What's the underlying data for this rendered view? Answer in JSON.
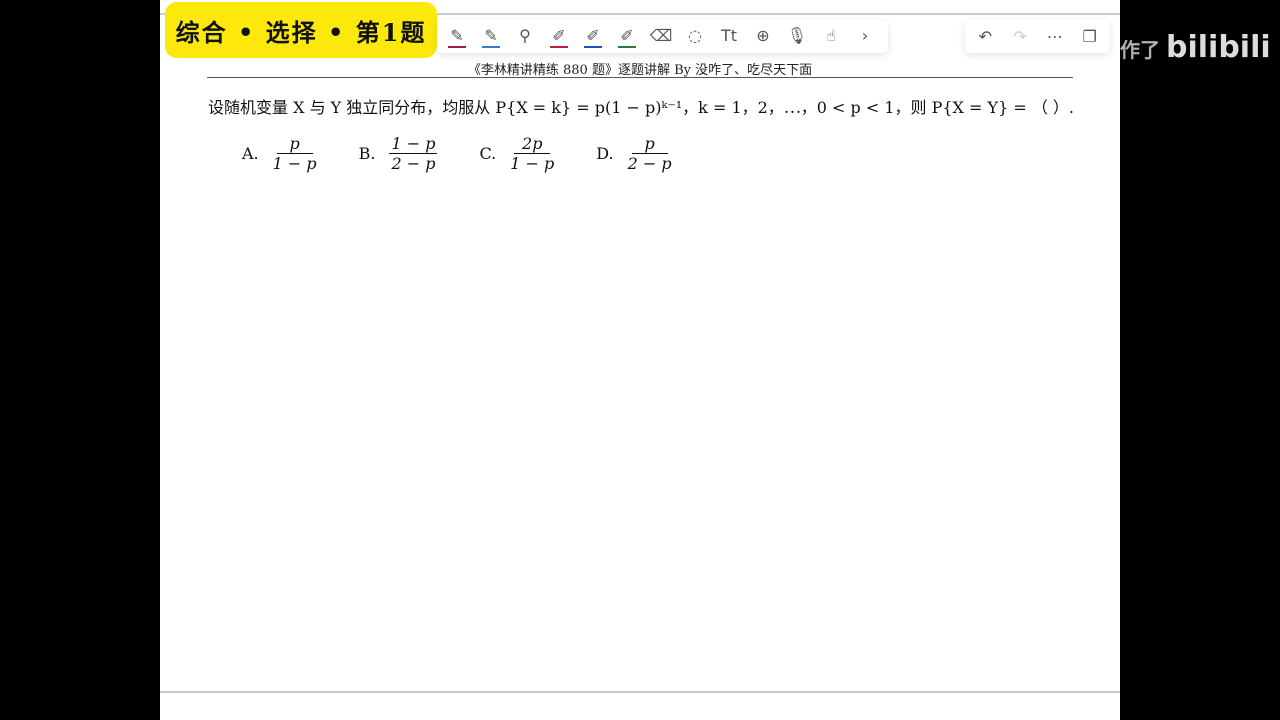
{
  "badge": {
    "text": "综合 • 选择 • 第1题"
  },
  "toolbar": {
    "tools": [
      {
        "icon": "pen-icon",
        "color": "#a02040"
      },
      {
        "icon": "pen-icon",
        "color": "#3a78c8"
      },
      {
        "icon": "link-pen-icon",
        "color": ""
      },
      {
        "icon": "highlighter-icon",
        "color": "#c02030"
      },
      {
        "icon": "highlighter-icon",
        "color": "#2050c0"
      },
      {
        "icon": "highlighter-icon",
        "color": "#2a7a3a"
      },
      {
        "icon": "eraser-icon",
        "color": ""
      },
      {
        "icon": "lasso-icon",
        "color": ""
      },
      {
        "icon": "text-icon",
        "color": ""
      },
      {
        "icon": "add-icon",
        "color": ""
      },
      {
        "icon": "microphone-icon",
        "color": ""
      },
      {
        "icon": "hand-icon",
        "color": ""
      },
      {
        "icon": "chevron-right-icon",
        "color": ""
      }
    ],
    "text_tool_label": "Tt"
  },
  "right_toolbar": {
    "icons": [
      "undo-icon",
      "redo-icon",
      "more-icon",
      "pages-icon"
    ]
  },
  "header": {
    "text": "《李林精讲精练 880 题》逐题讲解 By  没咋了、吃尽天下面"
  },
  "question": {
    "text": "设随机变量 X 与 Y 独立同分布，均服从 P{X = k} = p(1 − p)ᵏ⁻¹，k = 1，2，⋯，0 < p < 1，则 P{X = Y} = （      ）."
  },
  "options": [
    {
      "label": "A.",
      "num": "p",
      "den": "1 − p"
    },
    {
      "label": "B.",
      "num": "1 − p",
      "den": "2 − p"
    },
    {
      "label": "C.",
      "num": "2p",
      "den": "1 − p"
    },
    {
      "label": "D.",
      "num": "p",
      "den": "2 − p"
    }
  ],
  "watermark": {
    "text": "作了",
    "logo": "bilibili"
  }
}
